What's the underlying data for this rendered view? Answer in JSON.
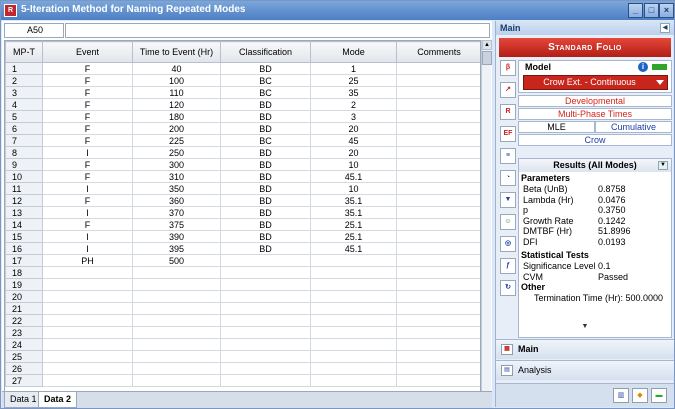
{
  "window": {
    "title": "5-Iteration Method for Naming Repeated Modes"
  },
  "cell_ref": "A50",
  "columns": [
    "MP-T",
    "Event",
    "Time to Event (Hr)",
    "Classification",
    "Mode",
    "Comments"
  ],
  "rows": [
    {
      "n": "1",
      "event": "F",
      "time": "40",
      "cls": "BD",
      "mode": "1"
    },
    {
      "n": "2",
      "event": "F",
      "time": "100",
      "cls": "BC",
      "mode": "25"
    },
    {
      "n": "3",
      "event": "F",
      "time": "110",
      "cls": "BC",
      "mode": "35"
    },
    {
      "n": "4",
      "event": "F",
      "time": "120",
      "cls": "BD",
      "mode": "2"
    },
    {
      "n": "5",
      "event": "F",
      "time": "180",
      "cls": "BD",
      "mode": "3"
    },
    {
      "n": "6",
      "event": "F",
      "time": "200",
      "cls": "BD",
      "mode": "20"
    },
    {
      "n": "7",
      "event": "F",
      "time": "225",
      "cls": "BC",
      "mode": "45"
    },
    {
      "n": "8",
      "event": "I",
      "time": "250",
      "cls": "BD",
      "mode": "20"
    },
    {
      "n": "9",
      "event": "F",
      "time": "300",
      "cls": "BD",
      "mode": "10"
    },
    {
      "n": "10",
      "event": "F",
      "time": "310",
      "cls": "BD",
      "mode": "45.1"
    },
    {
      "n": "11",
      "event": "I",
      "time": "350",
      "cls": "BD",
      "mode": "10"
    },
    {
      "n": "12",
      "event": "F",
      "time": "360",
      "cls": "BD",
      "mode": "35.1"
    },
    {
      "n": "13",
      "event": "I",
      "time": "370",
      "cls": "BD",
      "mode": "35.1"
    },
    {
      "n": "14",
      "event": "F",
      "time": "375",
      "cls": "BD",
      "mode": "25.1"
    },
    {
      "n": "15",
      "event": "I",
      "time": "390",
      "cls": "BD",
      "mode": "25.1"
    },
    {
      "n": "16",
      "event": "I",
      "time": "395",
      "cls": "BD",
      "mode": "45.1"
    },
    {
      "n": "17",
      "event": "PH",
      "time": "500",
      "cls": "",
      "mode": ""
    },
    {
      "n": "18",
      "event": "",
      "time": "",
      "cls": "",
      "mode": ""
    },
    {
      "n": "19",
      "event": "",
      "time": "",
      "cls": "",
      "mode": ""
    },
    {
      "n": "20",
      "event": "",
      "time": "",
      "cls": "",
      "mode": ""
    },
    {
      "n": "21",
      "event": "",
      "time": "",
      "cls": "",
      "mode": ""
    },
    {
      "n": "22",
      "event": "",
      "time": "",
      "cls": "",
      "mode": ""
    },
    {
      "n": "23",
      "event": "",
      "time": "",
      "cls": "",
      "mode": ""
    },
    {
      "n": "24",
      "event": "",
      "time": "",
      "cls": "",
      "mode": ""
    },
    {
      "n": "25",
      "event": "",
      "time": "",
      "cls": "",
      "mode": ""
    },
    {
      "n": "26",
      "event": "",
      "time": "",
      "cls": "",
      "mode": ""
    },
    {
      "n": "27",
      "event": "",
      "time": "",
      "cls": "",
      "mode": ""
    }
  ],
  "sheet_tabs": [
    "Data 1",
    "Data 2"
  ],
  "panel": {
    "header": "Main",
    "folio": "Standard Folio",
    "model_label": "Model",
    "model_value": "Crow Ext. - Continuous",
    "developmental": "Developmental",
    "multiphase": "Multi-Phase Times",
    "mle": "MLE",
    "cumulative": "Cumulative",
    "crow": "Crow",
    "results_title": "Results (All Modes)",
    "parameters": "Parameters",
    "params": [
      {
        "k": "Beta (UnB)",
        "v": "0.8758"
      },
      {
        "k": "Lambda (Hr)",
        "v": "0.0476"
      },
      {
        "k": "p",
        "v": "0.3750"
      },
      {
        "k": "Growth Rate",
        "v": "0.1242"
      },
      {
        "k": "DMTBF (Hr)",
        "v": "51.8996"
      },
      {
        "k": "DFI",
        "v": "0.0193"
      }
    ],
    "stat_tests": "Statistical Tests",
    "tests": [
      {
        "k": "Significance Level",
        "v": "0.1"
      },
      {
        "k": "CVM",
        "v": "Passed"
      }
    ],
    "other": "Other",
    "termination": "Termination Time (Hr): 500.0000",
    "nav_main": "Main",
    "nav_analysis": "Analysis"
  },
  "colors": {
    "accent_red": "#c8261d",
    "title_blue": "#4d7fc4",
    "panel_bg": "#e7eef8"
  }
}
